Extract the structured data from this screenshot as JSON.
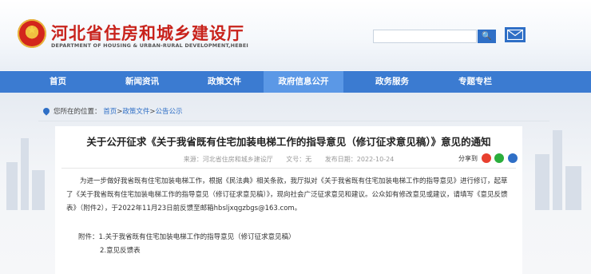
{
  "header": {
    "title_cn": "河北省住房和城乡建设厅",
    "title_en": "DEPARTMENT OF HOUSING & URBAN-RURAL DEVELOPMENT,HEBEI",
    "search_placeholder": "",
    "search_button": "🔍",
    "mail_icon": "mail-icon"
  },
  "nav": {
    "items": [
      {
        "label": "首页"
      },
      {
        "label": "新闻资讯"
      },
      {
        "label": "政策文件"
      },
      {
        "label": "政府信息公开"
      },
      {
        "label": "政务服务"
      },
      {
        "label": "专题专栏"
      }
    ],
    "active_index": 3
  },
  "breadcrumb": {
    "prefix": "您所在的位置：",
    "items": [
      "首页",
      "政策文件",
      "公告公示"
    ],
    "sep": ">"
  },
  "article": {
    "title": "关于公开征求《关于我省既有住宅加装电梯工作的指导意见（修订征求意见稿）》意见的通知",
    "meta": {
      "source": "来源：河北省住房和城乡建设厅",
      "doc_no": "文号：无",
      "date": "发布日期：2022-10-24"
    },
    "share_label": "分享到",
    "paragraph": "为进一步做好我省既有住宅加装电梯工作，根据《民法典》相关条款，我厅拟对《关于我省既有住宅加装电梯工作的指导意见》进行修订，起草了《关于我省既有住宅加装电梯工作的指导意见（修订征求意见稿）》，现向社会广泛征求意见和建议。公众如有修改意见或建议，请填写《意见反馈表》（附件2），于2022年11月23日前反馈至邮箱hbsljxqgzbgs@163.com。",
    "attachment_1": "附件：1.关于我省既有住宅加装电梯工作的指导意见（修订征求意见稿）",
    "attachment_2": "2.意见反馈表"
  },
  "colors": {
    "brand_red": "#c8221b",
    "nav_blue": "#3b7bd1",
    "nav_active": "#5b98e6"
  }
}
